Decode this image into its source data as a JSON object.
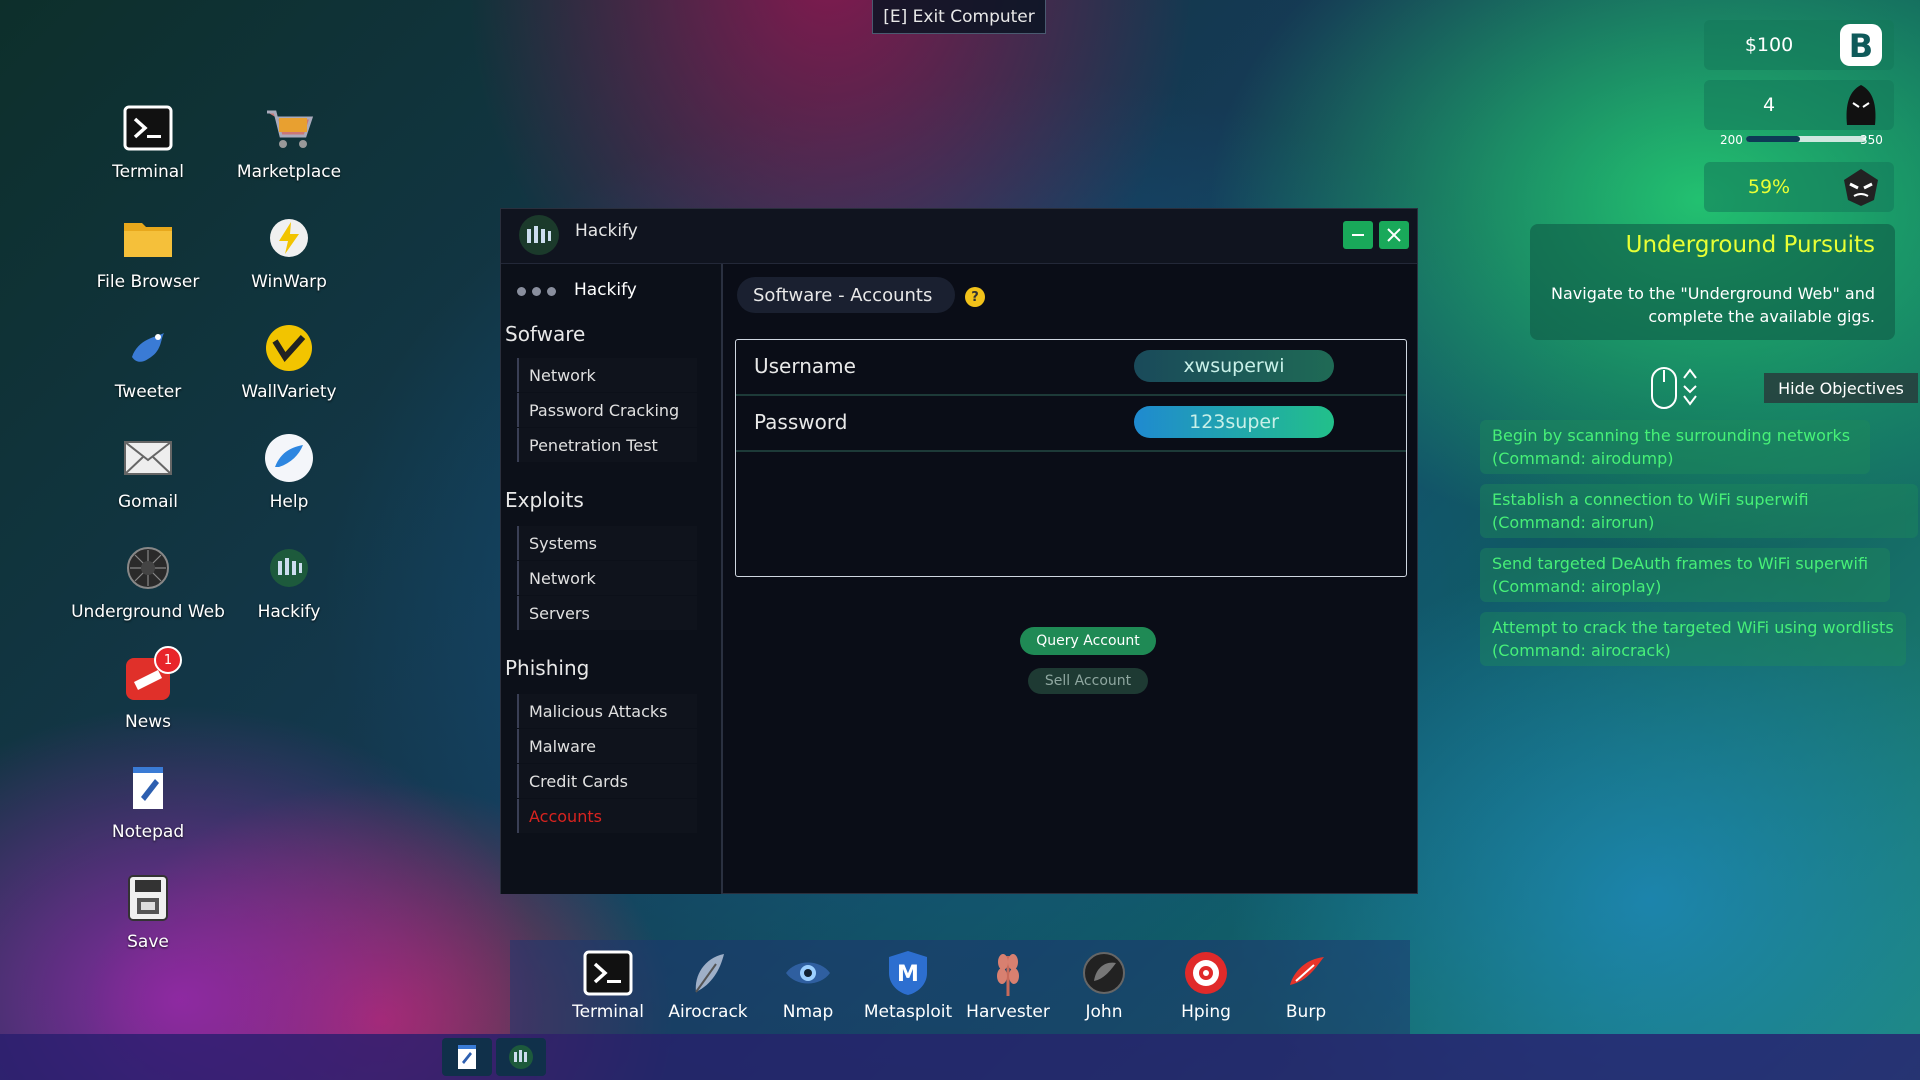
{
  "exit_button": "[E] Exit Computer",
  "desktop_icons": [
    {
      "label": "Terminal",
      "icon": "terminal-icon"
    },
    {
      "label": "Marketplace",
      "icon": "cart-icon"
    },
    {
      "label": "File Browser",
      "icon": "folder-icon"
    },
    {
      "label": "WinWarp",
      "icon": "lightning-icon"
    },
    {
      "label": "Tweeter",
      "icon": "bird-icon"
    },
    {
      "label": "WallVariety",
      "icon": "wallvariety-icon"
    },
    {
      "label": "Gomail",
      "icon": "mail-icon"
    },
    {
      "label": "Help",
      "icon": "help-bird-icon"
    },
    {
      "label": "Underground Web",
      "icon": "underground-icon"
    },
    {
      "label": "Hackify",
      "icon": "hackify-icon"
    },
    {
      "label": "News",
      "icon": "news-icon",
      "badge": "1"
    },
    {
      "label": "Notepad",
      "icon": "notepad-icon"
    },
    {
      "label": "Save",
      "icon": "save-icon"
    }
  ],
  "hud": {
    "money": "$100",
    "level": "4",
    "xp_min": "200",
    "xp_max": "350",
    "xp_fraction": 0.45,
    "percent": "59%"
  },
  "objective": {
    "title": "Underground Pursuits",
    "description": "Navigate to the \"Underground Web\" and complete the available gigs.",
    "hide_button": "Hide Objectives",
    "tasks": [
      "Begin by scanning the surrounding networks (Command: airodump)",
      "Establish a connection to WiFi superwifi (Command: airorun)",
      "Send targeted DeAuth frames to WiFi superwifi (Command: airoplay)",
      "Attempt to crack the targeted WiFi using wordlists (Command: airocrack)"
    ]
  },
  "window": {
    "title": "Hackify",
    "sidebar_header": "Hackify",
    "sections": [
      {
        "title": "Sofware",
        "items": [
          "Network",
          "Password Cracking",
          "Penetration Test"
        ]
      },
      {
        "title": "Exploits",
        "items": [
          "Systems",
          "Network",
          "Servers"
        ]
      },
      {
        "title": "Phishing",
        "items": [
          "Malicious Attacks",
          "Malware",
          "Credit Cards",
          "Accounts"
        ]
      }
    ],
    "content_tab": "Software - Accounts",
    "help": "?",
    "account": {
      "username_label": "Username",
      "username_value": "xwsuperwi",
      "password_label": "Password",
      "password_value": "123super",
      "query_button": "Query Account",
      "sell_button": "Sell Account"
    }
  },
  "dock": [
    {
      "label": "Terminal",
      "icon": "terminal-icon"
    },
    {
      "label": "Airocrack",
      "icon": "feather-icon"
    },
    {
      "label": "Nmap",
      "icon": "eye-icon"
    },
    {
      "label": "Metasploit",
      "icon": "shield-m-icon"
    },
    {
      "label": "Harvester",
      "icon": "wheat-icon"
    },
    {
      "label": "John",
      "icon": "john-icon"
    },
    {
      "label": "Hping",
      "icon": "target-icon"
    },
    {
      "label": "Burp",
      "icon": "burp-icon"
    }
  ],
  "colors": {
    "accent_green": "#19a95a",
    "active_red": "#d8231f",
    "objective_title": "#e8ff35",
    "task_green": "#4dff7a"
  }
}
